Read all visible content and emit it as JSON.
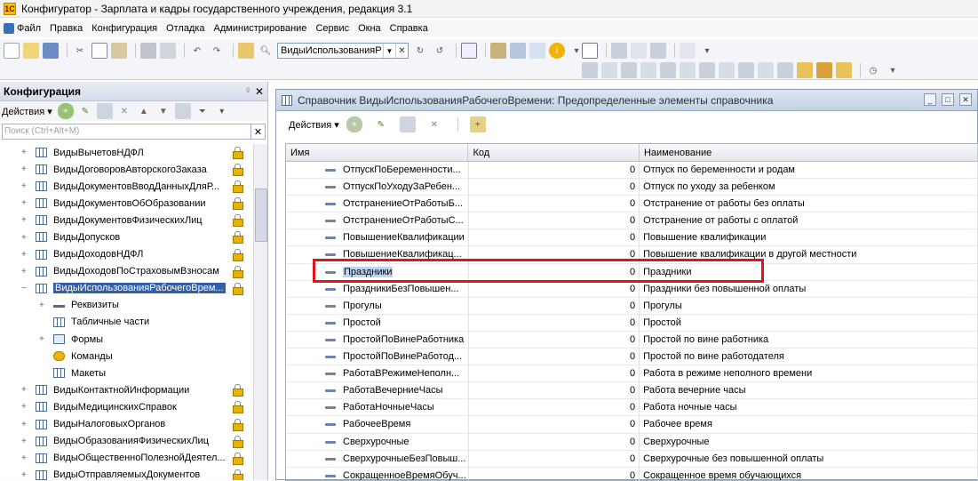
{
  "app": {
    "title": "Конфигуратор - Зарплата и кадры государственного учреждения, редакция 3.1",
    "icon_letter": "1C"
  },
  "menu": [
    {
      "label": "Файл",
      "icon": "file-icon",
      "color": "#3b6fb5"
    },
    {
      "label": "Правка",
      "icon": "",
      "color": ""
    },
    {
      "label": "Конфигурация",
      "icon": "",
      "color": ""
    },
    {
      "label": "Отладка",
      "icon": "",
      "color": ""
    },
    {
      "label": "Администрирование",
      "icon": "",
      "color": ""
    },
    {
      "label": "Сервис",
      "icon": "",
      "color": ""
    },
    {
      "label": "Окна",
      "icon": "",
      "color": ""
    },
    {
      "label": "Справка",
      "icon": "",
      "color": ""
    }
  ],
  "toolbar": {
    "search_combo_value": "ВидыИспользованияР",
    "dropdown_glyph": "▼",
    "clear_glyph": "✕"
  },
  "left_panel": {
    "title": "Конфигурация",
    "pin_glyph": "ᵍ",
    "close_glyph": "✕",
    "actions_label": "Действия",
    "search_placeholder": "Поиск (Ctrl+Alt+M)",
    "search_clear": "✕",
    "tree": [
      {
        "label": "ВидыВычетовНДФЛ",
        "level": 1,
        "icon": "catalog-icon",
        "locked": true,
        "expand": "+",
        "selected": false
      },
      {
        "label": "ВидыДоговоровАвторскогоЗаказа",
        "level": 1,
        "icon": "catalog-icon",
        "locked": true,
        "expand": "+",
        "selected": false
      },
      {
        "label": "ВидыДокументовВводДанныхДляР...",
        "level": 1,
        "icon": "catalog-icon",
        "locked": true,
        "expand": "+",
        "selected": false
      },
      {
        "label": "ВидыДокументовОбОбразовании",
        "level": 1,
        "icon": "catalog-icon",
        "locked": true,
        "expand": "+",
        "selected": false
      },
      {
        "label": "ВидыДокументовФизическихЛиц",
        "level": 1,
        "icon": "catalog-icon",
        "locked": true,
        "expand": "+",
        "selected": false
      },
      {
        "label": "ВидыДопусков",
        "level": 1,
        "icon": "catalog-icon",
        "locked": true,
        "expand": "+",
        "selected": false
      },
      {
        "label": "ВидыДоходовНДФЛ",
        "level": 1,
        "icon": "catalog-icon",
        "locked": true,
        "expand": "+",
        "selected": false
      },
      {
        "label": "ВидыДоходовПоСтраховымВзносам",
        "level": 1,
        "icon": "catalog-icon",
        "locked": true,
        "expand": "+",
        "selected": false
      },
      {
        "label": "ВидыИспользованияРабочегоВрем...",
        "level": 1,
        "icon": "catalog-icon",
        "locked": true,
        "expand": "−",
        "selected": true
      },
      {
        "label": "Реквизиты",
        "level": 2,
        "icon": "attributes-icon",
        "locked": false,
        "expand": "+",
        "selected": false
      },
      {
        "label": "Табличные части",
        "level": 2,
        "icon": "tabular-icon",
        "locked": false,
        "expand": "",
        "selected": false
      },
      {
        "label": "Формы",
        "level": 2,
        "icon": "forms-icon",
        "locked": false,
        "expand": "+",
        "selected": false
      },
      {
        "label": "Команды",
        "level": 2,
        "icon": "commands-icon",
        "locked": false,
        "expand": "",
        "selected": false
      },
      {
        "label": "Макеты",
        "level": 2,
        "icon": "templates-icon",
        "locked": false,
        "expand": "",
        "selected": false
      },
      {
        "label": "ВидыКонтактнойИнформации",
        "level": 1,
        "icon": "catalog-icon",
        "locked": true,
        "expand": "+",
        "selected": false
      },
      {
        "label": "ВидыМедицинскихСправок",
        "level": 1,
        "icon": "catalog-icon",
        "locked": true,
        "expand": "+",
        "selected": false
      },
      {
        "label": "ВидыНалоговыхОрганов",
        "level": 1,
        "icon": "catalog-icon",
        "locked": true,
        "expand": "+",
        "selected": false
      },
      {
        "label": "ВидыОбразованияФизическихЛиц",
        "level": 1,
        "icon": "catalog-icon",
        "locked": true,
        "expand": "+",
        "selected": false
      },
      {
        "label": "ВидыОбщественноПолезнойДеятел...",
        "level": 1,
        "icon": "catalog-icon",
        "locked": true,
        "expand": "+",
        "selected": false
      },
      {
        "label": "ВидыОтправляемыхДокументов",
        "level": 1,
        "icon": "catalog-icon",
        "locked": true,
        "expand": "+",
        "selected": false
      }
    ]
  },
  "window": {
    "title": "Справочник ВидыИспользованияРабочегоВремени: Предопределенные элементы справочника",
    "actions_label": "Действия",
    "columns": [
      "Имя",
      "Код",
      "Наименование"
    ],
    "rows": [
      {
        "name": "ОтпускПоБеременности...",
        "code": "0",
        "desc": "Отпуск по беременности и родам",
        "selected": false
      },
      {
        "name": "ОтпускПоУходуЗаРебен...",
        "code": "0",
        "desc": "Отпуск по уходу за ребенком",
        "selected": false
      },
      {
        "name": "ОтстранениеОтРаботыБ...",
        "code": "0",
        "desc": "Отстранение от работы без оплаты",
        "selected": false
      },
      {
        "name": "ОтстранениеОтРаботыС...",
        "code": "0",
        "desc": "Отстранение от работы с оплатой",
        "selected": false
      },
      {
        "name": "ПовышениеКвалификации",
        "code": "0",
        "desc": "Повышение квалификации",
        "selected": false
      },
      {
        "name": "ПовышениеКвалификац...",
        "code": "0",
        "desc": "Повышение квалификации в другой местности",
        "selected": false
      },
      {
        "name": "Праздники",
        "code": "0",
        "desc": "Праздники",
        "selected": true
      },
      {
        "name": "ПраздникиБезПовышен...",
        "code": "0",
        "desc": "Праздники без повышенной оплаты",
        "selected": false
      },
      {
        "name": "Прогулы",
        "code": "0",
        "desc": "Прогулы",
        "selected": false
      },
      {
        "name": "Простой",
        "code": "0",
        "desc": "Простой",
        "selected": false
      },
      {
        "name": "ПростойПоВинеРаботника",
        "code": "0",
        "desc": "Простой по вине работника",
        "selected": false
      },
      {
        "name": "ПростойПоВинеРаботод...",
        "code": "0",
        "desc": "Простой по вине работодателя",
        "selected": false
      },
      {
        "name": "РаботаВРежимеНеполн...",
        "code": "0",
        "desc": "Работа в режиме неполного времени",
        "selected": false
      },
      {
        "name": "РаботаВечерниеЧасы",
        "code": "0",
        "desc": "Работа вечерние часы",
        "selected": false
      },
      {
        "name": "РаботаНочныеЧасы",
        "code": "0",
        "desc": "Работа ночные часы",
        "selected": false
      },
      {
        "name": "РабочееВремя",
        "code": "0",
        "desc": "Рабочее время",
        "selected": false
      },
      {
        "name": "Сверхурочные",
        "code": "0",
        "desc": "Сверхурочные",
        "selected": false
      },
      {
        "name": "СверхурочныеБезПовыш...",
        "code": "0",
        "desc": "Сверхурочные без повышенной оплаты",
        "selected": false
      },
      {
        "name": "СокращенноеВремяОбуч...",
        "code": "0",
        "desc": "Сокращенное время обучающихся",
        "selected": false
      }
    ]
  },
  "colors": {
    "highlight": "#e0151c",
    "selection": "#3160a9"
  }
}
